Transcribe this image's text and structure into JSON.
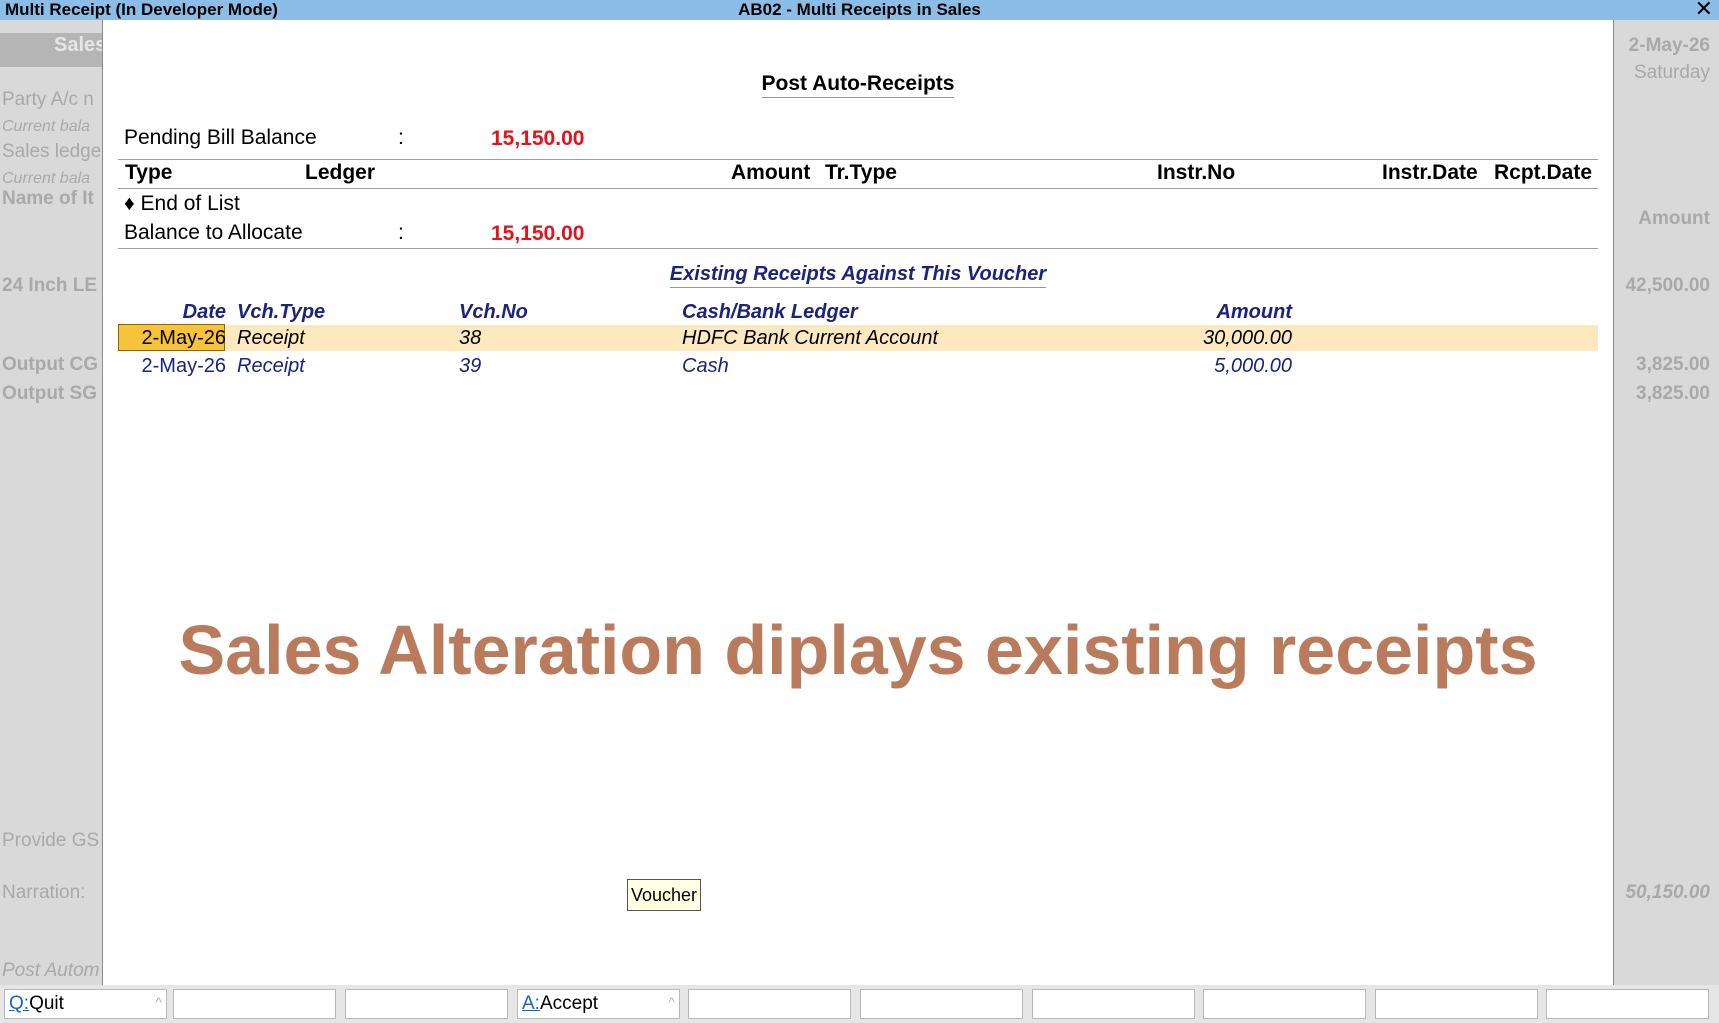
{
  "window": {
    "left_title": "Multi Receipt (In Developer Mode)",
    "center_title": "AB02 - Multi Receipts in Sales",
    "close_glyph": "✕"
  },
  "background": {
    "left": {
      "band": "Sales",
      "party": "Party A/c n",
      "current_bal_1": "Current bala",
      "sales_ledger": "Sales ledge",
      "current_bal_2": "Current bala",
      "name_of_item": "Name of It",
      "item": "24 Inch LE",
      "output_cg": "Output CG",
      "output_sg": "Output SG",
      "provide_gs": "Provide GS",
      "narration": "Narration:",
      "post_auto": "Post Autom"
    },
    "right": {
      "date": "2-May-26",
      "day": "Saturday",
      "amount_header": "Amount",
      "item_amount": "42,500.00",
      "cgst": "3,825.00",
      "sgst": "3,825.00",
      "total": "50,150.00"
    }
  },
  "modal": {
    "title": "Post Auto-Receipts",
    "pending_label": "Pending Bill Balance",
    "pending_colon": ":",
    "pending_value": "15,150.00",
    "headers": {
      "type": "Type",
      "ledger": "Ledger",
      "amount": "Amount",
      "tr_type": "Tr.Type",
      "instr_no": "Instr.No",
      "instr_date": "Instr.Date",
      "rcpt_date": "Rcpt.Date"
    },
    "end_of_list": "♦ End of List",
    "balance_label": "Balance to Allocate",
    "balance_colon": ":",
    "balance_value": "15,150.00",
    "existing_title": "Existing Receipts Against This Voucher",
    "existing_headers": {
      "date": "Date",
      "vch_type": "Vch.Type",
      "vch_no": "Vch.No",
      "ledger": "Cash/Bank Ledger",
      "amount": "Amount"
    },
    "existing_rows": [
      {
        "date": "2-May-26",
        "vch_type": "Receipt",
        "vch_no": "38",
        "ledger": "HDFC Bank Current Account",
        "amount": "30,000.00"
      },
      {
        "date": "2-May-26",
        "vch_type": "Receipt",
        "vch_no": "39",
        "ledger": "Cash",
        "amount": "5,000.00"
      }
    ],
    "caption": "Sales Alteration diplays existing receipts",
    "tooltip": "Voucher"
  },
  "footer": {
    "quit_key": "Q:",
    "quit_label": "Quit",
    "accept_key": "A:",
    "accept_label": "Accept",
    "caret": "^"
  }
}
